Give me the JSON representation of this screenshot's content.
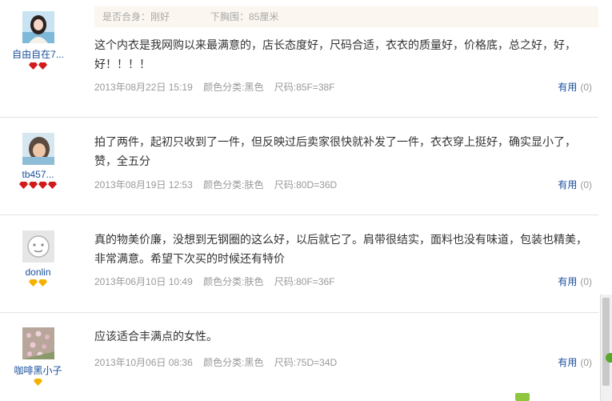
{
  "reviews": [
    {
      "user": "自由自在7...",
      "badge_color": "red",
      "badge_count": 2,
      "fit_label": "是否合身：刚好",
      "bust_label": "下胸围：85厘米",
      "text": "这个内衣是我网购以来最满意的，店长态度好，尺码合适，衣衣的质量好，价格底，总之好，好，好！！！！",
      "date": "2013年08月22日 15:19",
      "color": "颜色分类:黑色",
      "size": "尺码:85F=38F",
      "useful_label": "有用",
      "useful_count": "(0)"
    },
    {
      "user": "tb457...",
      "badge_color": "red",
      "badge_count": 4,
      "text": "拍了两件，起初只收到了一件，但反映过后卖家很快就补发了一件，衣衣穿上挺好，确实显小了，赞，全五分",
      "date": "2013年08月19日 12:53",
      "color": "颜色分类:肤色",
      "size": "尺码:80D=36D",
      "useful_label": "有用",
      "useful_count": "(0)"
    },
    {
      "user": "donlin",
      "badge_color": "yellow",
      "badge_count": 2,
      "text": "真的物美价廉，没想到无钢圈的这么好，以后就它了。肩带很结实，面料也没有味道，包装也精美，非常满意。希望下次买的时候还有特价",
      "date": "2013年06月10日 10:49",
      "color": "颜色分类:肤色",
      "size": "尺码:80F=36F",
      "useful_label": "有用",
      "useful_count": "(0)"
    },
    {
      "user": "咖啡黑小子",
      "badge_color": "yellow",
      "badge_count": 1,
      "text": "应该适合丰满点的女性。",
      "date": "2013年10月06日 08:36",
      "color": "颜色分类:黑色",
      "size": "尺码:75D=34D",
      "useful_label": "有用",
      "useful_count": "(0)"
    }
  ]
}
